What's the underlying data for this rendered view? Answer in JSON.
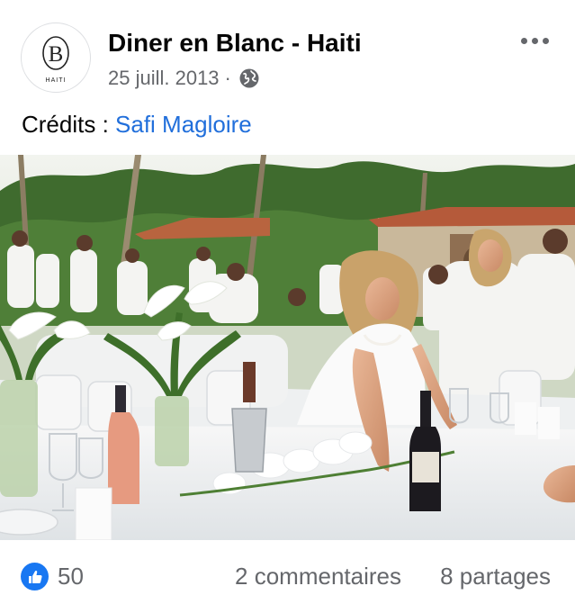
{
  "post": {
    "author": {
      "name": "Diner en Blanc - Haiti",
      "avatar_monogram": "B",
      "avatar_subtitle": "HAITI"
    },
    "date": "25 juill. 2013",
    "separator": "·",
    "audience_icon": "globe-icon",
    "more_icon": "more-options-icon",
    "caption": {
      "prefix": "Crédits : ",
      "link_text": "Safi Magloire"
    },
    "photo": {
      "subject": "outdoor white dinner party photo"
    },
    "reactions": {
      "icon": "like-icon",
      "count": "50"
    },
    "comments_label": "2 commentaires",
    "shares_label": "8 partages"
  },
  "colors": {
    "link": "#216fdb",
    "secondary_text": "#65676b",
    "like_blue": "#1877f2",
    "primary_text": "#050505"
  }
}
